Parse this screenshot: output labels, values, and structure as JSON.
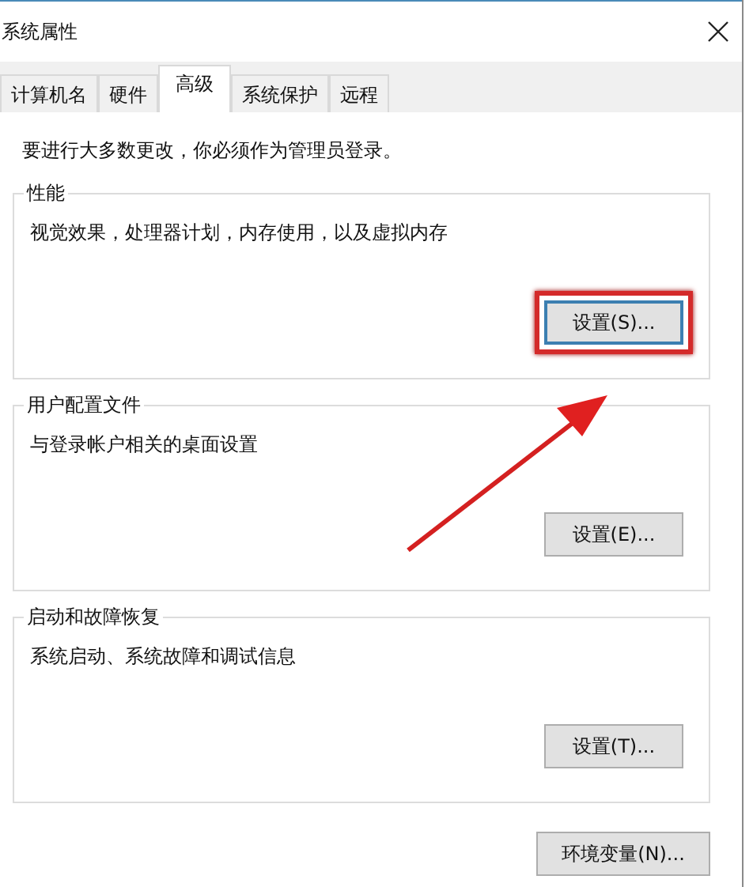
{
  "window": {
    "title": "系统属性"
  },
  "tabs": [
    {
      "label": "计算机名",
      "selected": false
    },
    {
      "label": "硬件",
      "selected": false
    },
    {
      "label": "高级",
      "selected": true
    },
    {
      "label": "系统保护",
      "selected": false
    },
    {
      "label": "远程",
      "selected": false
    }
  ],
  "notice": "要进行大多数更改，你必须作为管理员登录。",
  "sections": [
    {
      "title": "性能",
      "description": "视觉效果，处理器计划，内存使用，以及虚拟内存",
      "button": "设置(S)...",
      "highlighted": true
    },
    {
      "title": "用户配置文件",
      "description": "与登录帐户相关的桌面设置",
      "button": "设置(E)...",
      "highlighted": false
    },
    {
      "title": "启动和故障恢复",
      "description": "系统启动、系统故障和调试信息",
      "button": "设置(T)...",
      "highlighted": false
    }
  ],
  "bottom_button": "环境变量(N)..."
}
